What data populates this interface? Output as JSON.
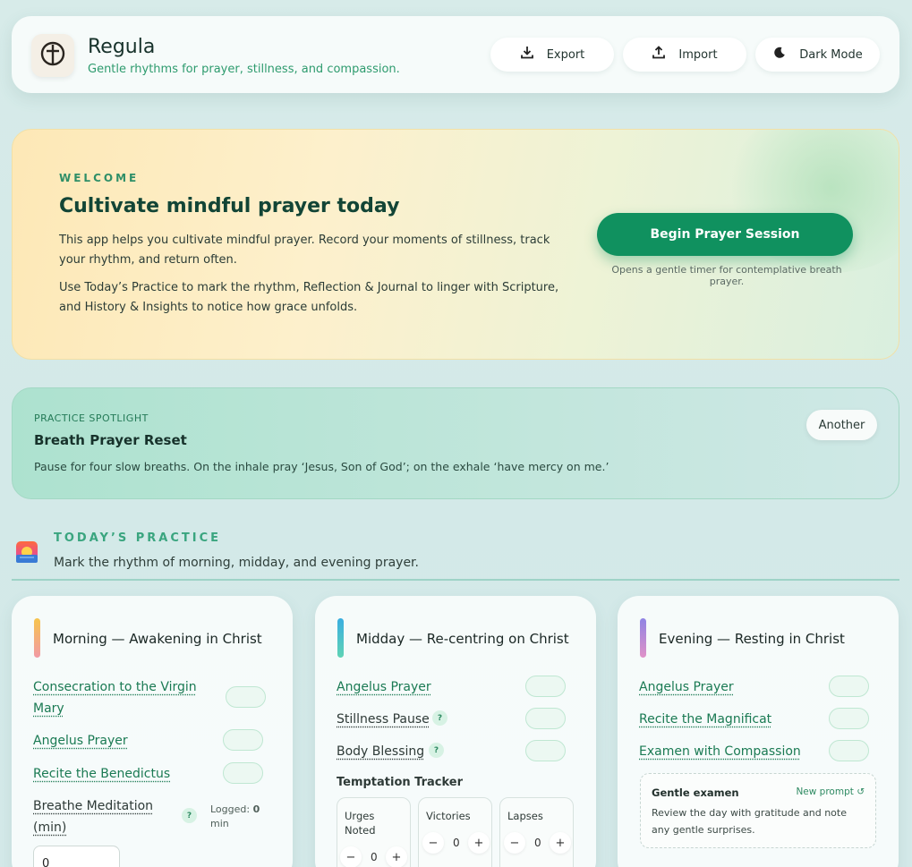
{
  "header": {
    "title": "Regula",
    "subtitle": "Gentle rhythms for prayer, stillness, and compassion.",
    "buttons": {
      "export": "Export",
      "import": "Import",
      "dark_mode": "Dark Mode"
    }
  },
  "welcome": {
    "eyebrow": "WELCOME",
    "title": "Cultivate mindful prayer today",
    "paragraph1": "This app helps you cultivate mindful prayer. Record your moments of stillness, track your rhythm, and return often.",
    "paragraph2": "Use Today’s Practice to mark the rhythm, Reflection & Journal to linger with Scripture, and History & Insights to notice how grace unfolds.",
    "cta": "Begin Prayer Session",
    "cta_note": "Opens a gentle timer for contemplative breath prayer."
  },
  "spotlight": {
    "eyebrow": "PRACTICE SPOTLIGHT",
    "title": "Breath Prayer Reset",
    "text": "Pause for four slow breaths. On the inhale pray ‘Jesus, Son of God’; on the exhale ‘have mercy on me.’",
    "another": "Another"
  },
  "today": {
    "eyebrow": "TODAY’S PRACTICE",
    "subtitle": "Mark the rhythm of morning, midday, and evening prayer."
  },
  "morning": {
    "title": "Morning — Awakening in Christ",
    "accent": "#f0c060",
    "items": [
      "Consecration to the Virgin Mary",
      "Angelus Prayer",
      "Recite the Benedictus"
    ],
    "meditation_label": "Breathe Meditation (min)",
    "help": "?",
    "logged_prefix": "Logged:",
    "logged_value": "0",
    "logged_unit": "min",
    "input_value": "0"
  },
  "midday": {
    "title": "Midday — Re-centring on Christ",
    "accent": "#3cbfd0",
    "items": [
      "Angelus Prayer",
      "Stillness Pause",
      "Body Blessing"
    ],
    "help": "?",
    "tracker_title": "Temptation Tracker",
    "counters": [
      {
        "label": "Urges Noted",
        "value": "0"
      },
      {
        "label": "Victories",
        "value": "0"
      },
      {
        "label": "Lapses",
        "value": "0"
      }
    ],
    "minus": "−",
    "plus": "+"
  },
  "evening": {
    "title": "Evening — Resting in Christ",
    "accent": "#9a88e0",
    "items": [
      "Angelus Prayer",
      "Recite the Magnificat",
      "Examen with Compassion"
    ],
    "examen_title": "Gentle examen",
    "examen_new": "New prompt ↺",
    "examen_text": "Review the day with gratitude and note any gentle surprises."
  }
}
